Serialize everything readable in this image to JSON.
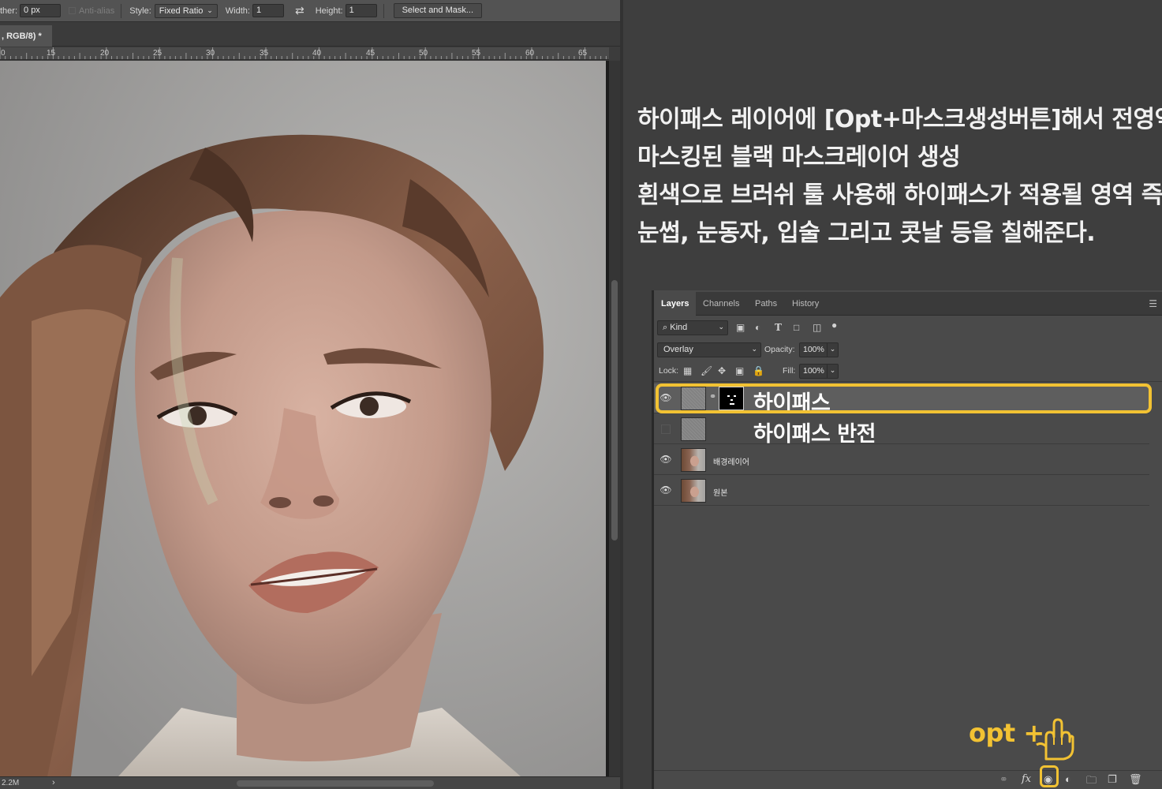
{
  "options_bar": {
    "feather_label": "ther:",
    "feather_value": "0 px",
    "antialias_label": "Anti-alias",
    "style_label": "Style:",
    "style_value": "Fixed Ratio",
    "width_label": "Width:",
    "width_value": "1",
    "height_label": "Height:",
    "height_value": "1",
    "select_mask_label": "Select and Mask...",
    "swap_icon": "swap-arrows-icon"
  },
  "document": {
    "tab_title": ", RGB/8) *",
    "ruler_marks": [
      "0",
      "15",
      "20",
      "25",
      "30",
      "35",
      "40",
      "45",
      "50",
      "55",
      "60",
      "65"
    ],
    "status_size": "2.2M",
    "status_arrow": "›"
  },
  "instructions": {
    "line1": "하이패스 레이어에 [Opt+마스크생성버튼]해서 전영역",
    "line2": "마스킹된 블랙 마스크레이어 생성",
    "line3": "흰색으로 브러쉬 툴 사용해 하이패스가 적용될 영역 즉,",
    "line4": "눈썹, 눈동자, 입술 그리고 콧날 등을 칠해준다."
  },
  "layers_panel": {
    "tabs": [
      "Layers",
      "Channels",
      "Paths",
      "History"
    ],
    "active_tab": "Layers",
    "filter_kind": "Kind",
    "blend_mode": "Overlay",
    "opacity_label": "Opacity:",
    "opacity_value": "100%",
    "lock_label": "Lock:",
    "fill_label": "Fill:",
    "fill_value": "100%",
    "layers": [
      {
        "name": "하이패스",
        "visible": true,
        "has_mask": true,
        "selected": true
      },
      {
        "name": "하이패스 반전",
        "visible": false,
        "has_mask": false,
        "selected": false
      },
      {
        "name": "배경레이어",
        "visible": true,
        "has_mask": false,
        "selected": false
      },
      {
        "name": "원본",
        "visible": true,
        "has_mask": false,
        "selected": false
      }
    ]
  },
  "callout": {
    "text": "opt +",
    "color": "#f2c233"
  },
  "colors": {
    "highlight": "#f2c233",
    "panel_bg": "#4a4a4a",
    "workspace_bg": "#3e3e3e"
  }
}
